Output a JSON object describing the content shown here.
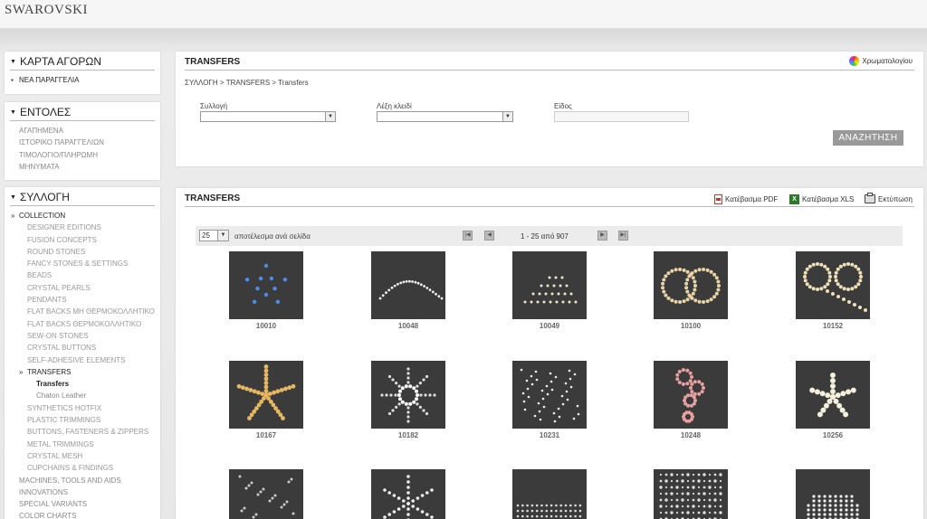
{
  "brand": "SWAROVSKI",
  "sidebar": {
    "cart": {
      "title": "ΚΑΡΤΑ ΑΓΟΡΩΝ",
      "items": [
        "ΝΕΑ ΠΑΡΑΓΓΕΛΙΑ"
      ]
    },
    "commands": {
      "title": "ΕΝΤΟΛΕΣ",
      "items": [
        "ΑΓΑΠΗΜΕΝΑ",
        "ΙΣΤΟΡΙΚΟ ΠΑΡΑΓΓΕΛΙΩΝ",
        "ΤΙΜΟΛΟΓΙΟ/ΠΛΗΡΩΜΗ",
        "ΜΗΝΥΜΑΤΑ"
      ]
    },
    "collection": {
      "title": "ΣΥΛΛΟΓΗ",
      "root": "COLLECTION",
      "items": [
        "DESIGNER EDITIONS",
        "FUSION CONCEPTS",
        "ROUND STONES",
        "FANCY STONES & SETTINGS",
        "BEADS",
        "CRYSTAL PEARLS",
        "PENDANTS",
        "FLAT BACKS ΜΗ ΘΕΡΜΟΚΟΛΛΗΤΙΚΟ",
        "FLAT BACKS ΘΕΡΜΟΚΟΛΛΗΤΙΚΟ",
        "SEW-ON STONES",
        "CRYSTAL BUTTONS",
        "SELF-ADHESIVE ELEMENTS"
      ],
      "active": "TRANSFERS",
      "sub_items": [
        "Transfers",
        "Chaton Leather"
      ],
      "items_after": [
        "SYNTHETICS HOTFIX",
        "PLASTIC TRIMMINGS",
        "BUTTONS, FASTENERS & ZIPPERS",
        "METAL TRIMMINGS",
        "CRYSTAL MESH",
        "CUPCHAINS & FINDINGS"
      ],
      "bottom": [
        "MACHINES, TOOLS AND AIDS",
        "INNOVATIONS",
        "SPECIAL VARIANTS",
        "COLOR CHARTS"
      ]
    }
  },
  "search_panel": {
    "title": "TRANSFERS",
    "color_chart_link": "Χρωματολογίου",
    "breadcrumb": "ΣΥΛΛΟΓΗ  >  TRANSFERS  >  Transfers",
    "collection_label": "Συλλογή",
    "keyword_label": "Λέξη κλειδί",
    "type_label": "Είδος",
    "search_button": "ΑΝΑΖΗΤΗΣΗ"
  },
  "results_panel": {
    "title": "TRANSFERS",
    "download_pdf": "Κατέβασμα PDF",
    "download_xls": "Κατέβασμα XLS",
    "print": "Εκτύπωση",
    "per_page": "25",
    "per_page_label": "αποτέλεσμα ανά σελίδα",
    "range": "1 - 25  από 907"
  },
  "products": [
    "10010",
    "10048",
    "10049",
    "10100",
    "10152",
    "10167",
    "10182",
    "10231",
    "10248",
    "10256",
    "",
    "",
    "",
    "",
    ""
  ],
  "colors": {
    "accent_button": "#999999",
    "thumb_bg": "#3b3b3b"
  }
}
